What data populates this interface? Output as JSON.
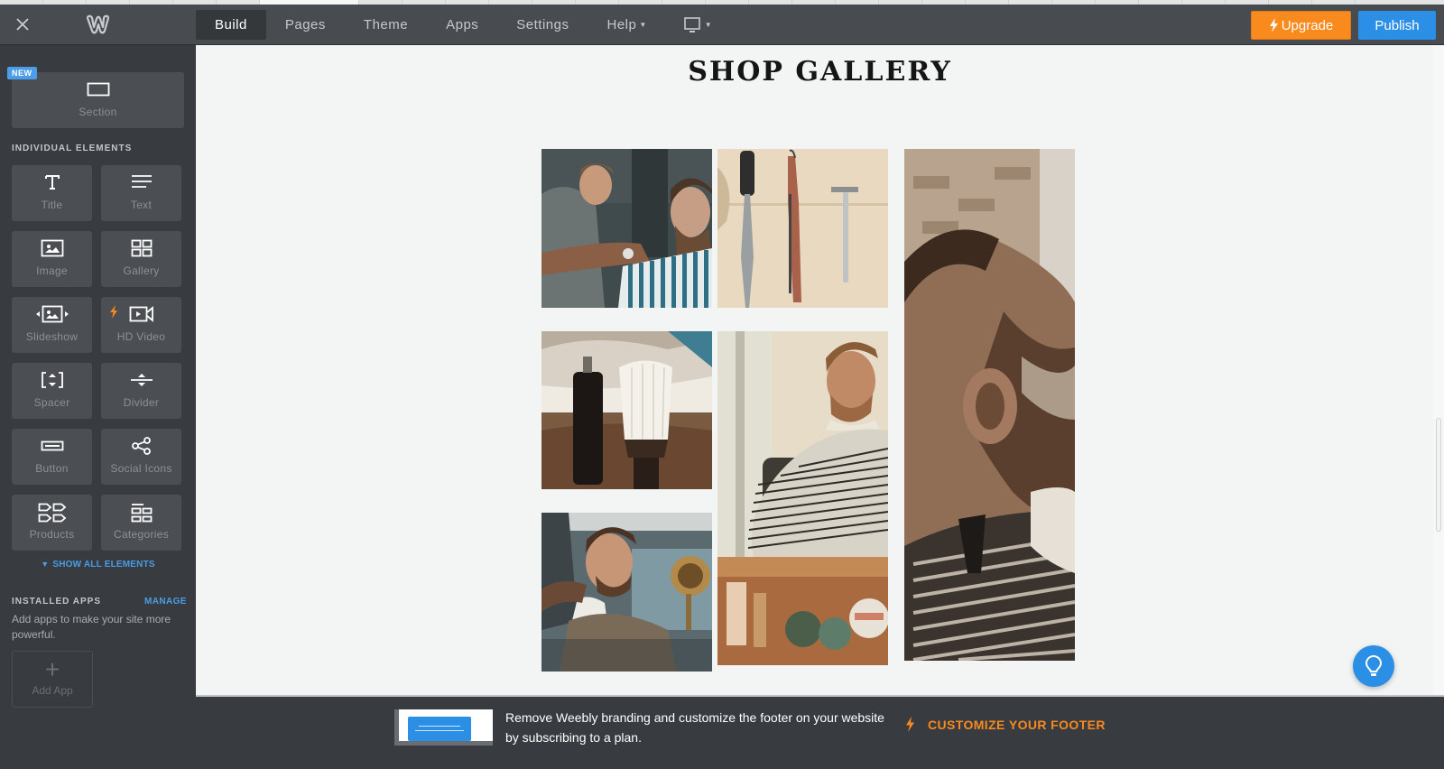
{
  "topbar": {
    "close_icon": "close-icon",
    "logo_icon": "weebly-logo-icon",
    "nav": [
      {
        "label": "Build",
        "active": true
      },
      {
        "label": "Pages",
        "active": false
      },
      {
        "label": "Theme",
        "active": false
      },
      {
        "label": "Apps",
        "active": false
      },
      {
        "label": "Settings",
        "active": false
      },
      {
        "label": "Help",
        "active": false,
        "has_dropdown": true
      }
    ],
    "device_icon": "desktop-monitor-icon",
    "upgrade_label": "Upgrade",
    "publish_label": "Publish",
    "colors": {
      "upgrade": "#f98a1e",
      "publish": "#2b8fe6"
    }
  },
  "sidebar": {
    "section": {
      "badge": "NEW",
      "label": "Section",
      "icon": "section-rectangle-icon"
    },
    "individual_elements_label": "INDIVIDUAL ELEMENTS",
    "elements": [
      {
        "label": "Title",
        "icon": "title-t-icon"
      },
      {
        "label": "Text",
        "icon": "text-lines-icon"
      },
      {
        "label": "Image",
        "icon": "image-icon"
      },
      {
        "label": "Gallery",
        "icon": "gallery-grid-icon"
      },
      {
        "label": "Slideshow",
        "icon": "slideshow-icon"
      },
      {
        "label": "HD Video",
        "icon": "video-camera-icon",
        "premium": true
      },
      {
        "label": "Spacer",
        "icon": "spacer-icon"
      },
      {
        "label": "Divider",
        "icon": "divider-icon"
      },
      {
        "label": "Button",
        "icon": "button-icon"
      },
      {
        "label": "Social Icons",
        "icon": "share-icon"
      },
      {
        "label": "Products",
        "icon": "products-tags-icon"
      },
      {
        "label": "Categories",
        "icon": "categories-icon"
      }
    ],
    "show_all_label": "SHOW ALL ELEMENTS",
    "installed_apps_label": "INSTALLED APPS",
    "manage_label": "MANAGE",
    "apps_description": "Add apps to make your site more powerful.",
    "add_app_label": "Add App"
  },
  "canvas": {
    "page_title": "SHOP GALLERY",
    "gallery": [
      {
        "subject": "barber cutting client's hair"
      },
      {
        "subject": "comb, straight razor and safety razor"
      },
      {
        "subject": "man with beard leaning back"
      },
      {
        "subject": "oil bottle and neck duster brush"
      },
      {
        "subject": "bearded man in barber chair"
      },
      {
        "subject": "man in suit getting haircut"
      }
    ],
    "help_icon": "lightbulb-icon"
  },
  "footer": {
    "message": "Remove Weebly branding and customize the footer on your website by subscribing to a plan.",
    "cta_label": "CUSTOMIZE YOUR FOOTER",
    "cta_color": "#f98a1e"
  }
}
